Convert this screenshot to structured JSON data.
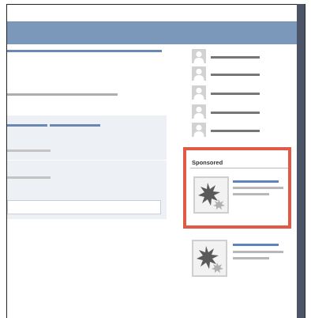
{
  "sidebar": {
    "contacts": [
      {
        "name": ""
      },
      {
        "name": ""
      },
      {
        "name": ""
      },
      {
        "name": ""
      },
      {
        "name": ""
      }
    ],
    "sponsored_label": "Sponsored"
  },
  "colors": {
    "header_bar": "#7b97ba",
    "right_gutter": "#4b5567",
    "highlight": "#e05a46",
    "feed_card": "#edf0f5",
    "link_blue": "#6b88b5"
  },
  "icons": {
    "avatar": "person-silhouette-icon",
    "ad_image": "image-placeholder-icon"
  }
}
